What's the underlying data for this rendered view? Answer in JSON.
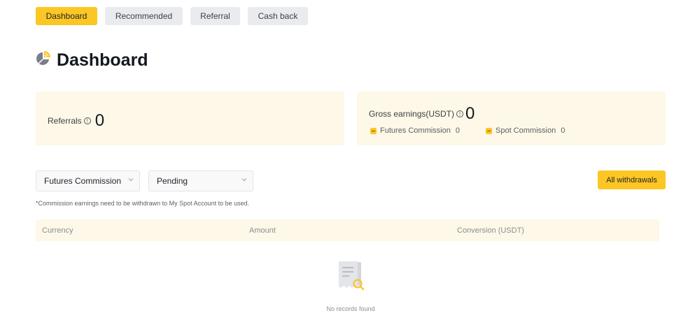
{
  "tabs": [
    {
      "label": "Dashboard",
      "active": true
    },
    {
      "label": "Recommended",
      "active": false
    },
    {
      "label": "Referral",
      "active": false
    },
    {
      "label": "Cash back",
      "active": false
    }
  ],
  "page": {
    "title": "Dashboard",
    "title_icon": "pie-chart-icon"
  },
  "referrals": {
    "label": "Referrals",
    "value": "0"
  },
  "earnings": {
    "label": "Gross earnings(USDT)",
    "value": "0",
    "futures_label": "Futures Commission",
    "futures_value": "0",
    "spot_label": "Spot Commission",
    "spot_value": "0"
  },
  "filters": {
    "type_value": "Futures Commission",
    "status_value": "Pending"
  },
  "actions": {
    "withdrawals_label": "All withdrawals"
  },
  "note": "*Commission earnings need to be withdrawn to My Spot Account to be used.",
  "table": {
    "columns": [
      "Currency",
      "Amount",
      "Conversion (USDT)"
    ],
    "empty_text": "No records found"
  },
  "colors": {
    "accent": "#fcc624",
    "card_bg": "#fdf8e7"
  }
}
